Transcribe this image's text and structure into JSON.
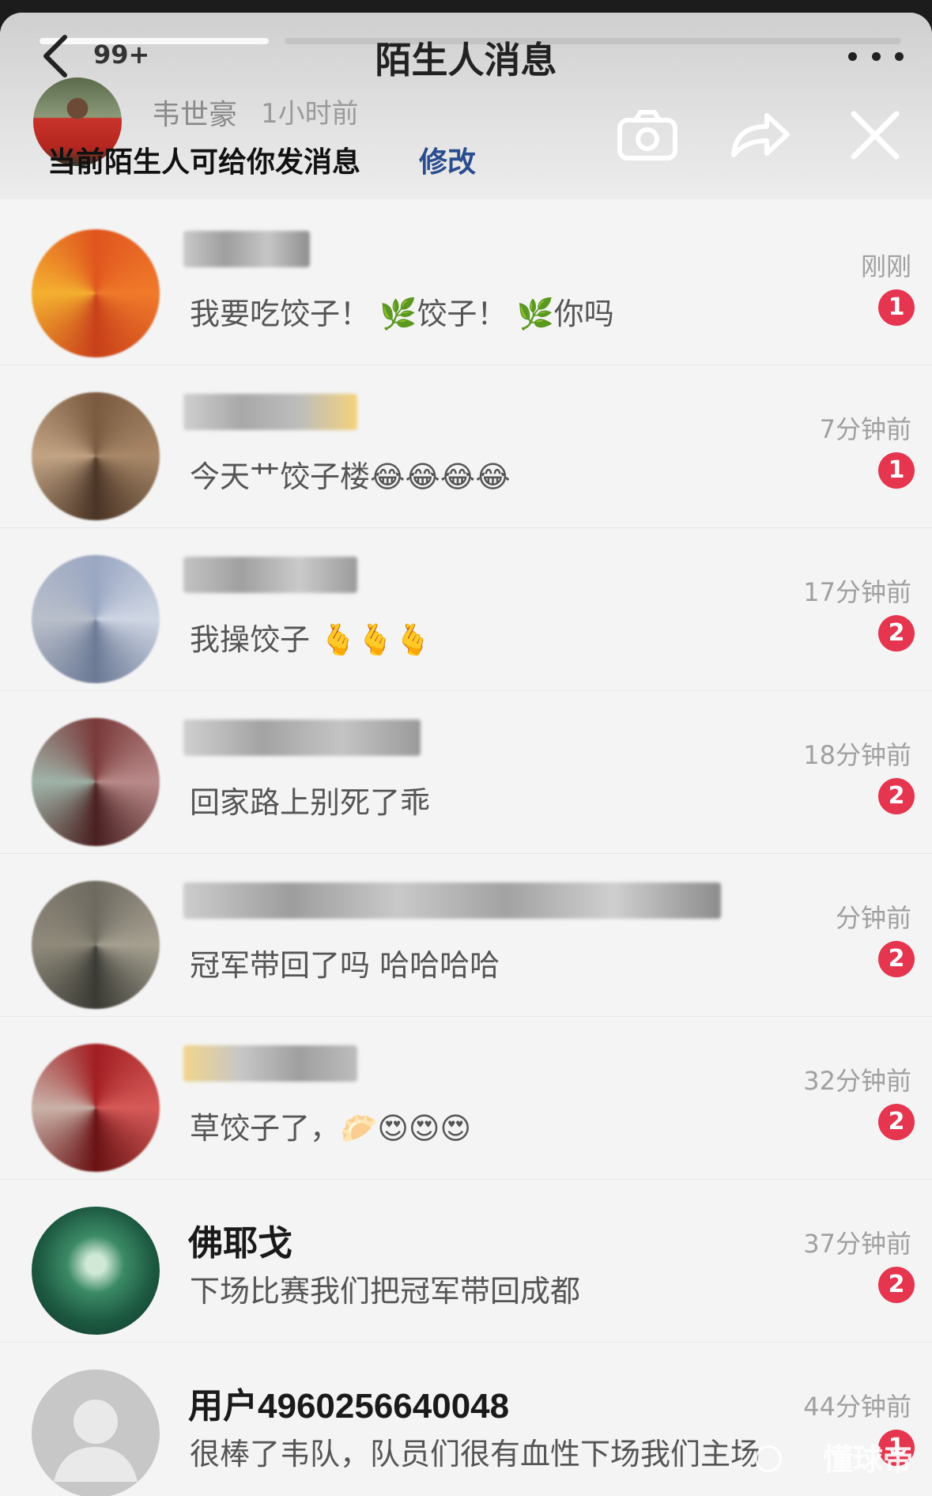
{
  "header": {
    "title": "陌生人消息",
    "unread_count": "99+",
    "story": {
      "name": "韦世豪",
      "time": "1小时前",
      "caption": "当前陌生人可给你发消息",
      "edit_label": "修改"
    }
  },
  "conversations": [
    {
      "name": "",
      "time": "刚刚",
      "message": "我要吃饺子！ 🌿饺子！ 🌿你吗",
      "unread": "1"
    },
    {
      "name": "",
      "time": "7分钟前",
      "message": "今天艹饺子楼😂😂😂😂",
      "unread": "1"
    },
    {
      "name": "",
      "time": "17分钟前",
      "message": "我操饺子 🫰🫰🫰",
      "unread": "2"
    },
    {
      "name": "",
      "time": "18分钟前",
      "message": "回家路上别死了乖",
      "unread": "2"
    },
    {
      "name": "",
      "time": "分钟前",
      "message": "冠军带回了吗 哈哈哈哈",
      "unread": "2"
    },
    {
      "name": "",
      "time": "32分钟前",
      "message": "草饺子了，🥟😍😍😍",
      "unread": "2"
    },
    {
      "name": "佛耶戈",
      "time": "37分钟前",
      "message": "下场比赛我们把冠军带回成都",
      "unread": "2"
    },
    {
      "name": "用户4960256640048",
      "time": "44分钟前",
      "message": "很棒了韦队，队员们很有血性下场我们主场",
      "unread": "1"
    }
  ],
  "watermark": "懂球帝",
  "colors": {
    "unread_badge": "#e5354f",
    "edit_link": "#2a4d8f"
  }
}
